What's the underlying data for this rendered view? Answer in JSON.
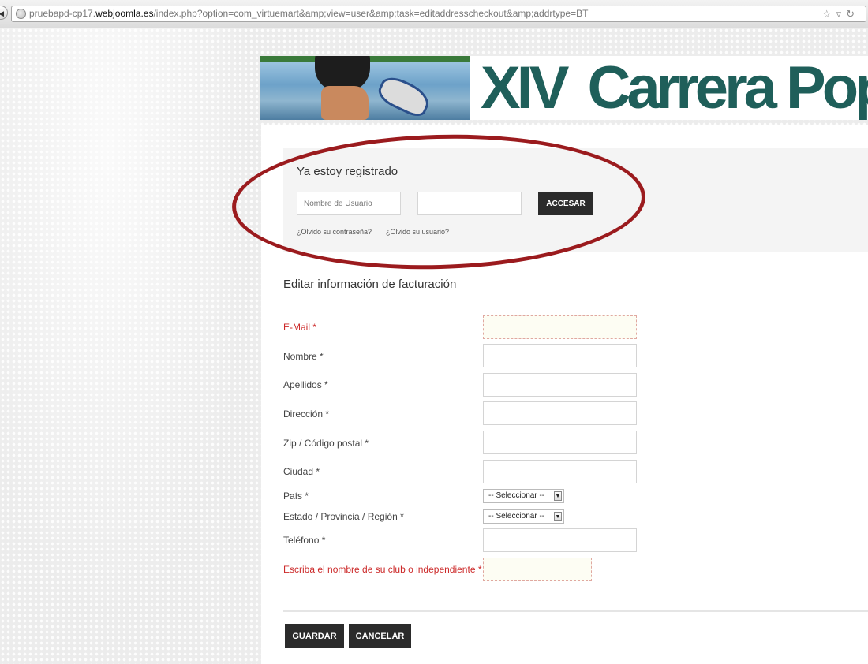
{
  "browser": {
    "url_prefix": "pruebapd-cp17.",
    "url_host": "webjoomla.es",
    "url_path": "/index.php?option=com_virtuemart&amp;view=user&amp;task=editaddresscheckout&amp;addrtype=BT",
    "icons": [
      "back-icon",
      "globe-icon",
      "star-icon",
      "dropdown-icon",
      "reload-icon"
    ]
  },
  "banner": {
    "title_roman": "XIV",
    "title_text": "Carrera Popu"
  },
  "login": {
    "title": "Ya estoy registrado",
    "username_placeholder": "Nombre de Usuario",
    "password_value": "",
    "submit_label": "ACCESAR",
    "forgot_password": "¿Olvido su contraseña?",
    "forgot_username": "¿Olvido su usuario?"
  },
  "form": {
    "heading": "Editar información de facturación",
    "fields": {
      "email": "E-Mail *",
      "nombre": "Nombre *",
      "apellidos": "Apellidos *",
      "direccion": "Dirección *",
      "zip": "Zip / Código postal *",
      "ciudad": "Ciudad *",
      "pais": "País *",
      "estado": "Estado / Provincia / Región *",
      "telefono": "Teléfono *",
      "club": "Escriba el nombre de su club o independiente *"
    },
    "select_placeholder": "-- Seleccionar --",
    "save_label": "GUARDAR",
    "cancel_label": "CANCELAR"
  },
  "colors": {
    "required_red": "#cc2a2a",
    "banner_teal": "#1f5f5a",
    "button_dark": "#2b2b2b",
    "annotation_red": "#9b1b1e"
  }
}
